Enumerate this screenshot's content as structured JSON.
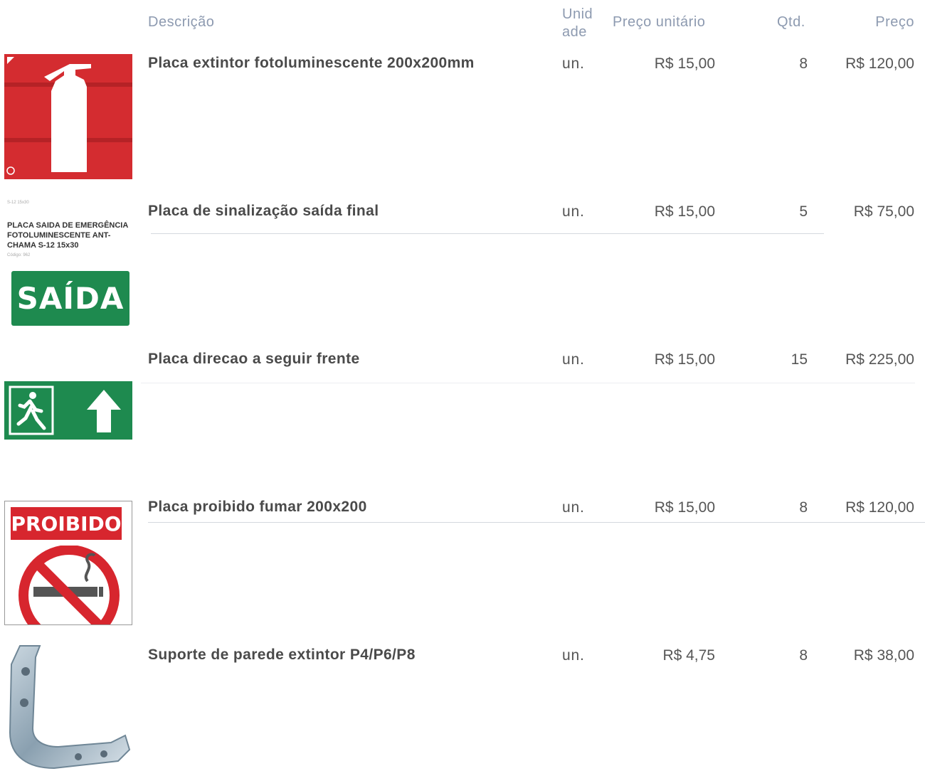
{
  "header": {
    "description": "Descrição",
    "unit": "Unid ade",
    "unit_price": "Preço unitário",
    "qty": "Qtd.",
    "price": "Preço"
  },
  "items": [
    {
      "description": "Placa extintor fotoluminescente 200x200mm",
      "unit": "un.",
      "unit_price": "R$ 15,00",
      "qty": "8",
      "price": "R$ 120,00",
      "image_icon": "fire-extinguisher-sign-icon"
    },
    {
      "description": "Placa de sinalização saída final",
      "unit": "un.",
      "unit_price": "R$ 15,00",
      "qty": "5",
      "price": "R$ 75,00",
      "image_icon": "exit-sign-icon",
      "image_caption": "PLACA SAIDA DE EMERGÊNCIA FOTOLUMINESCENTE ANT-CHAMA S-12 15x30",
      "image_code": "Código: 962",
      "image_top_small": "S-12 15x30",
      "sign_text": "SAÍDA"
    },
    {
      "description": "Placa direcao a seguir frente",
      "unit": "un.",
      "unit_price": "R$ 15,00",
      "qty": "15",
      "price": "R$ 225,00",
      "image_icon": "exit-arrow-up-sign-icon"
    },
    {
      "description": "Placa proibido fumar 200x200",
      "unit": "un.",
      "unit_price": "R$ 15,00",
      "qty": "8",
      "price": "R$ 120,00",
      "image_icon": "no-smoking-sign-icon",
      "sign_text": "PROIBIDO"
    },
    {
      "description": "Suporte de parede extintor P4/P6/P8",
      "unit": "un.",
      "unit_price": "R$ 4,75",
      "qty": "8",
      "price": "R$ 38,00",
      "image_icon": "wall-bracket-icon"
    }
  ],
  "colors": {
    "header_text": "#8d9ab0",
    "sign_red": "#d7262e",
    "sign_green": "#1e8a4f"
  }
}
